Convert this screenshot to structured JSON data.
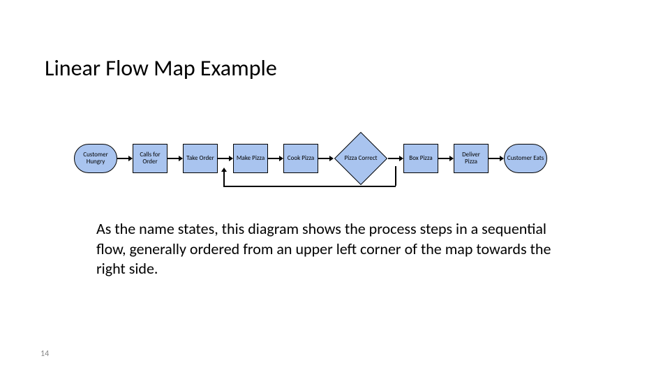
{
  "title": "Linear Flow Map Example",
  "flow": {
    "start": "Customer Hungry",
    "steps": [
      "Calls for Order",
      "Take Order",
      "Make Pizza",
      "Cook Pizza"
    ],
    "decision": "Pizza Correct",
    "after_decision": [
      "Box Pizza",
      "Deliver Pizza"
    ],
    "end": "Customer Eats"
  },
  "description": "As the name states, this diagram shows the process steps in a sequential flow, generally ordered from an upper left corner of the map towards the right side.",
  "page_number": "14"
}
